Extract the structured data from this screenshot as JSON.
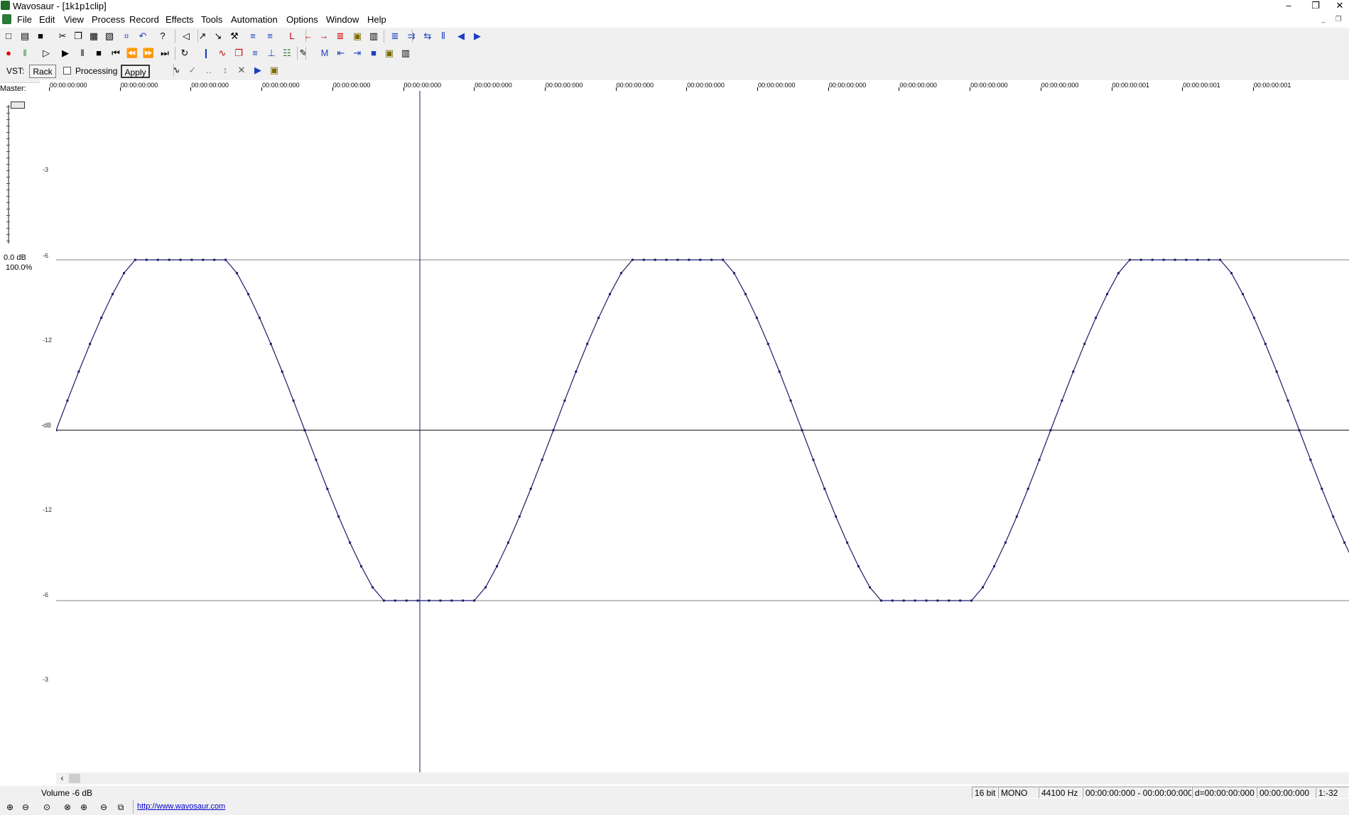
{
  "window": {
    "title": "Wavosaur - [1k1p1clip]",
    "minimize_glyph": "–",
    "restore_glyph": "❐",
    "close_glyph": "✕"
  },
  "menu": [
    "File",
    "Edit",
    "View",
    "Process",
    "Record",
    "Effects",
    "Tools",
    "Automation",
    "Options",
    "Window",
    "Help"
  ],
  "mdi_controls": {
    "minimize_glyph": "_",
    "restore_glyph": "❐"
  },
  "toolbar1": [
    {
      "icon": "new-file-icon",
      "glyph": "□",
      "color": "#000000"
    },
    {
      "icon": "open-folder-icon",
      "glyph": "▤",
      "color": "#000000"
    },
    {
      "icon": "save-icon",
      "glyph": "■",
      "color": "#000000"
    },
    {
      "icon": "cut-icon",
      "glyph": "✂",
      "color": "#000000"
    },
    {
      "icon": "copy-icon",
      "glyph": "❐",
      "color": "#000000"
    },
    {
      "icon": "paste-icon",
      "glyph": "▦",
      "color": "#000000"
    },
    {
      "icon": "paste-special-icon",
      "glyph": "▧",
      "color": "#000000"
    },
    {
      "icon": "trim-icon",
      "glyph": "⌗",
      "color": "#1a3fbf"
    },
    {
      "icon": "undo-icon",
      "glyph": "↶",
      "color": "#1a3fbf"
    },
    {
      "icon": "help-icon",
      "glyph": "?",
      "color": "#000000"
    },
    {
      "icon": "speaker-icon",
      "glyph": "◁",
      "color": "#000000"
    },
    {
      "icon": "fade-in-icon",
      "glyph": "↗",
      "color": "#000000"
    },
    {
      "icon": "fade-out-icon",
      "glyph": "↘",
      "color": "#000000"
    },
    {
      "icon": "wrench-icon",
      "glyph": "⚒",
      "color": "#000000"
    },
    {
      "icon": "wave-left-icon",
      "glyph": "≡",
      "color": "#1a3fbf"
    },
    {
      "icon": "wave-right-icon",
      "glyph": "≡",
      "color": "#1a3fbf"
    },
    {
      "icon": "marker-red-icon",
      "glyph": "L",
      "color": "#cc0000"
    },
    {
      "icon": "marker-left-icon",
      "glyph": "←",
      "color": "#cc0000"
    },
    {
      "icon": "marker-right-icon",
      "glyph": "→",
      "color": "#cc0000"
    },
    {
      "icon": "marker-all-icon",
      "glyph": "≣",
      "color": "#cc0000"
    },
    {
      "icon": "lock-icon",
      "glyph": "▣",
      "color": "#7a6a00"
    },
    {
      "icon": "trash-icon",
      "glyph": "▥",
      "color": "#000000"
    },
    {
      "icon": "zoom-wave-icon",
      "glyph": "≣",
      "color": "#1a3fbf"
    },
    {
      "icon": "split-icon",
      "glyph": "⇉",
      "color": "#1a3fbf"
    },
    {
      "icon": "merge-icon",
      "glyph": "⇆",
      "color": "#1a3fbf"
    },
    {
      "icon": "loop-icon",
      "glyph": "⦀",
      "color": "#1a3fbf"
    },
    {
      "icon": "nav-left-icon",
      "glyph": "◀",
      "color": "#1a3fbf"
    },
    {
      "icon": "nav-right-icon",
      "glyph": "▶",
      "color": "#1a3fbf"
    }
  ],
  "toolbar2": [
    {
      "icon": "record-icon",
      "glyph": "●",
      "color": "#e00000"
    },
    {
      "icon": "pause-record-icon",
      "glyph": "‖",
      "color": "#2e8b2e"
    },
    {
      "icon": "play-from-cursor-icon",
      "glyph": "▷",
      "color": "#000000"
    },
    {
      "icon": "play-icon",
      "glyph": "▶",
      "color": "#000000"
    },
    {
      "icon": "pause-icon",
      "glyph": "‖",
      "color": "#000000"
    },
    {
      "icon": "stop-icon",
      "glyph": "■",
      "color": "#000000"
    },
    {
      "icon": "go-start-icon",
      "glyph": "⏮",
      "color": "#000000"
    },
    {
      "icon": "rewind-icon",
      "glyph": "⏪",
      "color": "#000000"
    },
    {
      "icon": "fast-forward-icon",
      "glyph": "⏩",
      "color": "#000000"
    },
    {
      "icon": "go-end-icon",
      "glyph": "⏭",
      "color": "#000000"
    },
    {
      "icon": "loop-play-icon",
      "glyph": "↻",
      "color": "#000000"
    },
    {
      "icon": "insert-icon",
      "glyph": "❙",
      "color": "#1a3fbf"
    },
    {
      "icon": "spectrum-icon",
      "glyph": "∿",
      "color": "#cc0000"
    },
    {
      "icon": "copy-region-icon",
      "glyph": "❐",
      "color": "#cc0000"
    },
    {
      "icon": "normalize-icon",
      "glyph": "≡",
      "color": "#1a3fbf"
    },
    {
      "icon": "dc-offset-icon",
      "glyph": "⊥",
      "color": "#1a3fbf"
    },
    {
      "icon": "eq-icon",
      "glyph": "☷",
      "color": "#2e6b2e"
    },
    {
      "icon": "pencil-icon",
      "glyph": "✎",
      "color": "#000000"
    },
    {
      "icon": "marker-m-icon",
      "glyph": "M",
      "color": "#1a3fbf"
    },
    {
      "icon": "prev-marker-icon",
      "glyph": "⇤",
      "color": "#1a3fbf"
    },
    {
      "icon": "next-marker-icon",
      "glyph": "⇥",
      "color": "#1a3fbf"
    },
    {
      "icon": "region-icon",
      "glyph": "■",
      "color": "#1a3fbf"
    },
    {
      "icon": "lock2-icon",
      "glyph": "▣",
      "color": "#7a6a00"
    },
    {
      "icon": "trash2-icon",
      "glyph": "▥",
      "color": "#000000"
    }
  ],
  "toolbar3": {
    "vst_label": "VST:",
    "rack_label": "Rack",
    "processing_label": "Processing",
    "apply_label": "Apply",
    "icons": [
      {
        "icon": "envelope-icon",
        "glyph": "∿",
        "color": "#000000"
      },
      {
        "icon": "check-icon",
        "glyph": "✓",
        "color": "#888888"
      },
      {
        "icon": "dots-icon",
        "glyph": "‥",
        "color": "#888888"
      },
      {
        "icon": "arrows-icon",
        "glyph": "↕",
        "color": "#888888"
      },
      {
        "icon": "close-x-icon",
        "glyph": "✕",
        "color": "#555555"
      },
      {
        "icon": "play-box-icon",
        "glyph": "▶",
        "color": "#1a3fbf"
      },
      {
        "icon": "lock3-icon",
        "glyph": "▣",
        "color": "#7a6a00"
      }
    ]
  },
  "timeline_ticks": [
    "00:00:00:000",
    "00:00:00:000",
    "00:00:00:000",
    "00:00:00:000",
    "00:00:00:000",
    "00:00:00:000",
    "00:00:00:000",
    "00:00:00:000",
    "00:00:00:000",
    "00:00:00:000",
    "00:00:00:000",
    "00:00:00:000",
    "00:00:00:000",
    "00:00:00:000",
    "00:00:00:000",
    "00:00:00:001",
    "00:00:00:001",
    "00:00:00:001"
  ],
  "master": {
    "label": "Master:",
    "db": "0.0 dB",
    "percent": "100.0%"
  },
  "db_scale": [
    "-3",
    "-6",
    "-12",
    "-dB",
    "-12",
    "-6",
    "-3"
  ],
  "waveform": {
    "line_color": "#1b1b6b",
    "grid_color": "#808080",
    "center_color": "#000000",
    "cursor_color": "#1b1b6b",
    "samples_per_cycle": 44,
    "cycles_visible": 2.6
  },
  "status": {
    "text": "Volume -6 dB",
    "bits": "16 bit",
    "channels": "MONO",
    "rate": "44100 Hz",
    "selection": "00:00:00:000 - 00:00:00:000",
    "duration": "d=00:00:00:000",
    "position": "00:00:00:000",
    "zoom": "1:-32"
  },
  "bottom": {
    "url": "http://www.wavosaur.com",
    "zoom_icons": [
      {
        "icon": "zoom-in-icon",
        "glyph": "⊕"
      },
      {
        "icon": "zoom-out-icon",
        "glyph": "⊖"
      },
      {
        "icon": "zoom-fit-icon",
        "glyph": "⊙"
      },
      {
        "icon": "zoom-selection-icon",
        "glyph": "⊗"
      },
      {
        "icon": "zoom-vertical-in-icon",
        "glyph": "⊕"
      },
      {
        "icon": "zoom-vertical-out-icon",
        "glyph": "⊖"
      },
      {
        "icon": "zoom-all-icon",
        "glyph": "⧉"
      }
    ]
  }
}
